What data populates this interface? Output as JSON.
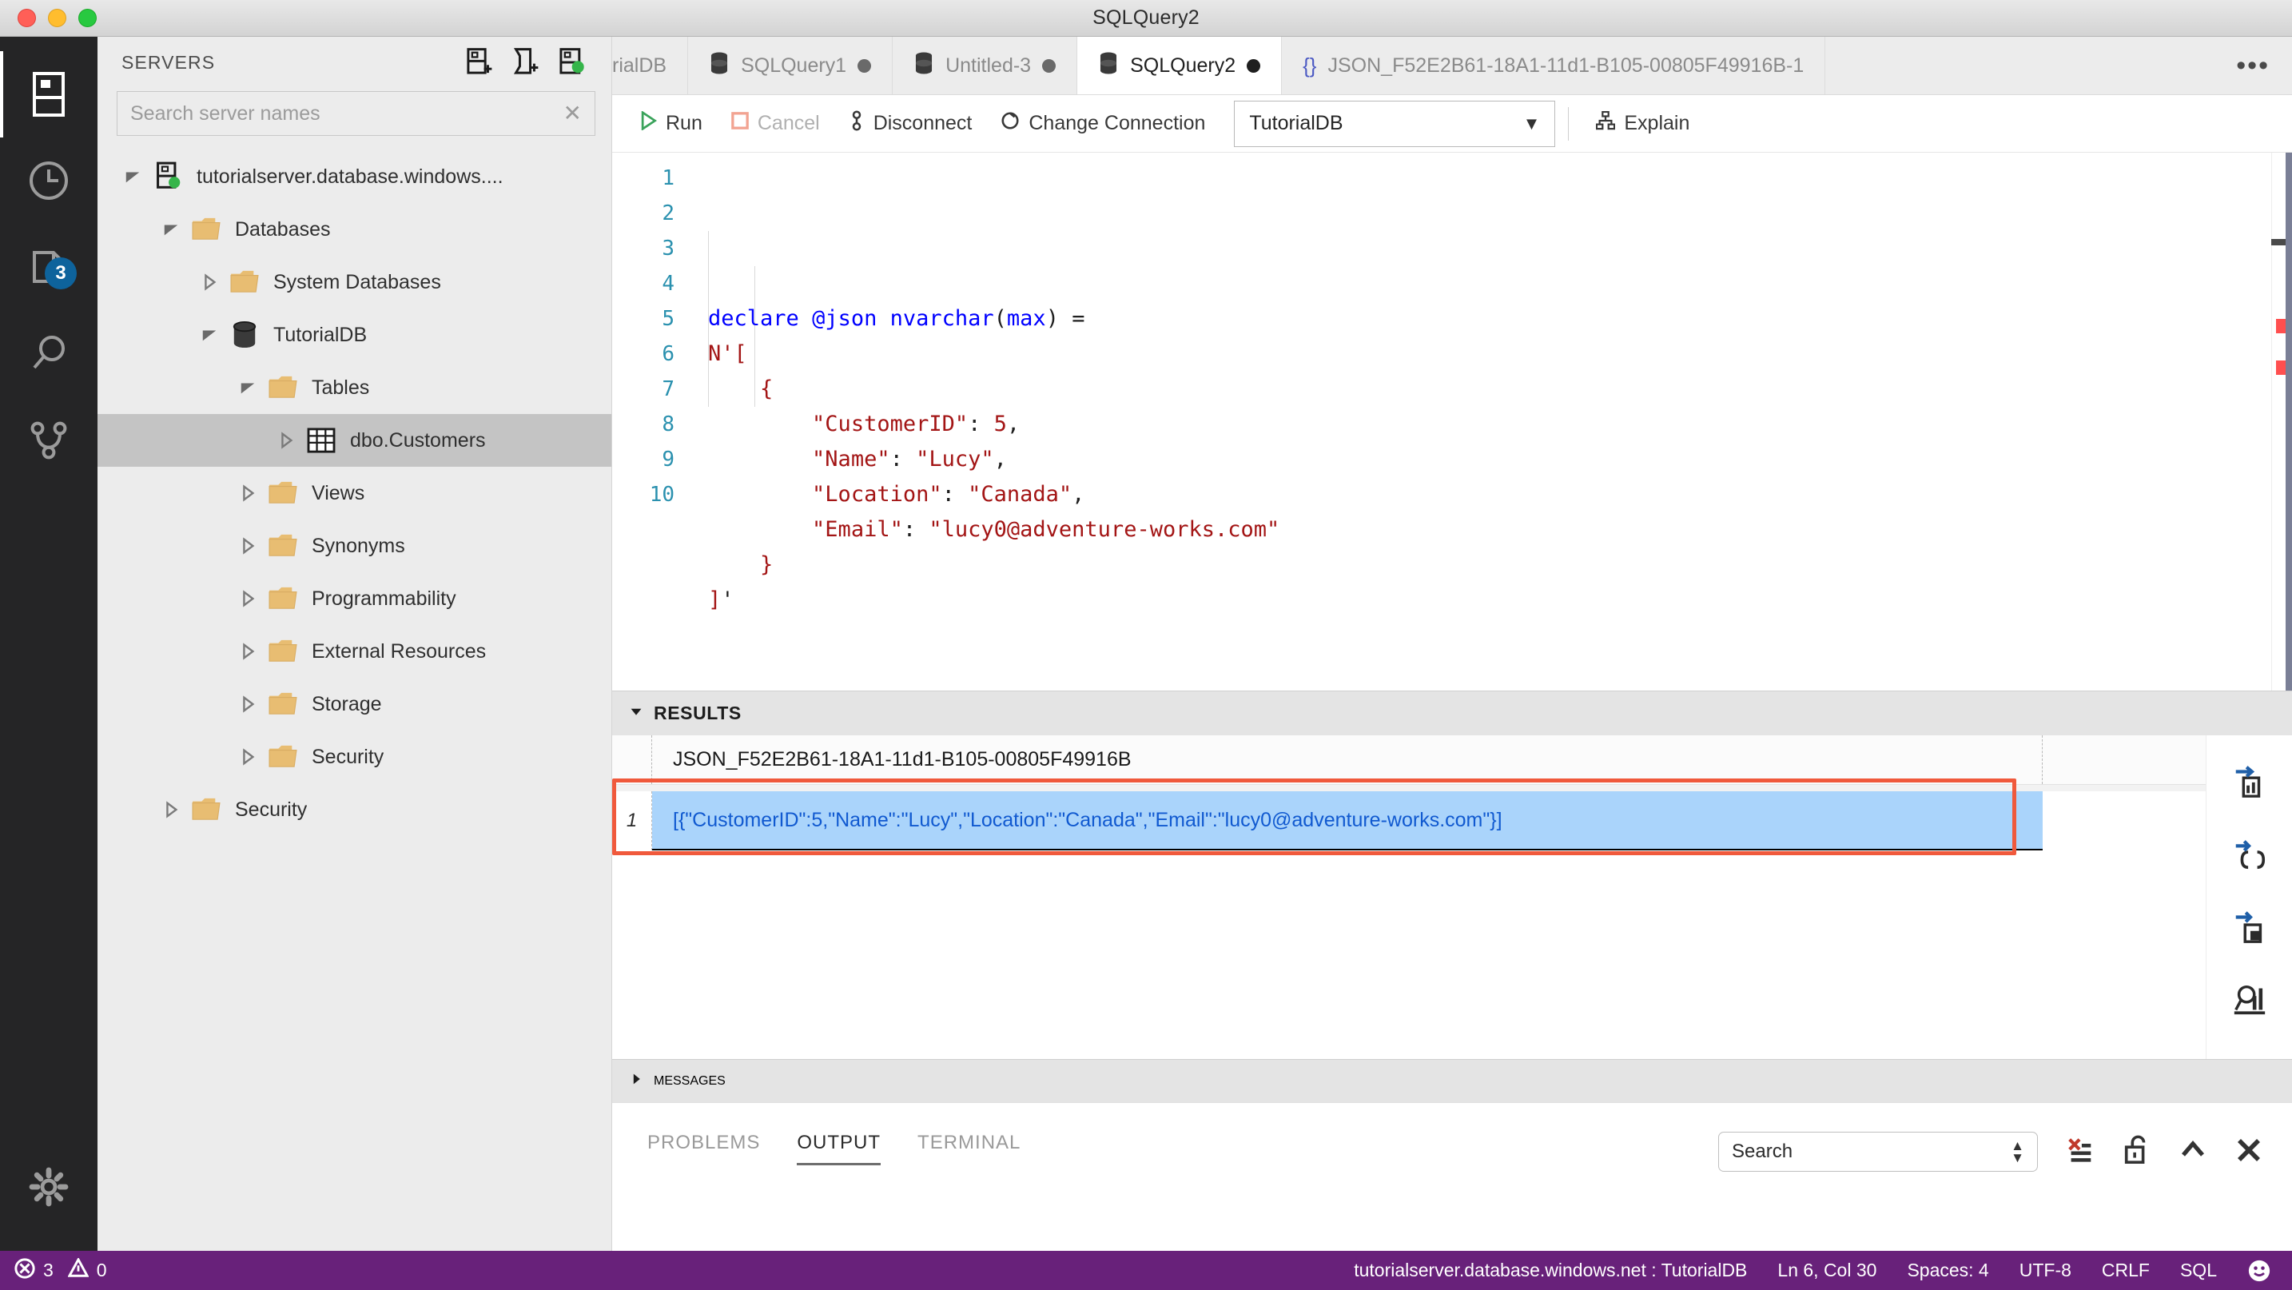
{
  "window": {
    "title": "SQLQuery2",
    "traffic_lights": [
      "close",
      "minimize",
      "zoom"
    ]
  },
  "activity_bar": {
    "items": [
      {
        "name": "servers",
        "icon": "server-icon",
        "active": true,
        "badge": ""
      },
      {
        "name": "history",
        "icon": "clock-icon",
        "active": false,
        "badge": ""
      },
      {
        "name": "explorer",
        "icon": "files-icon",
        "active": false,
        "badge": "3"
      },
      {
        "name": "search",
        "icon": "search-icon",
        "active": false,
        "badge": ""
      },
      {
        "name": "source-control",
        "icon": "source-control-icon",
        "active": false,
        "badge": ""
      }
    ],
    "bottom": {
      "name": "manage",
      "icon": "gear-icon"
    }
  },
  "sidebar": {
    "title": "SERVERS",
    "actions": [
      {
        "name": "add-connection",
        "icon": "new-connection-icon"
      },
      {
        "name": "new-server-group",
        "icon": "new-server-group-icon"
      },
      {
        "name": "show-active-connections",
        "icon": "active-connections-icon"
      }
    ],
    "search": {
      "placeholder": "Search server names",
      "value": "",
      "clear": "✕"
    },
    "tree": [
      {
        "label": "tutorialserver.database.windows....",
        "icon": "server-icon",
        "depth": 0,
        "state": "expanded",
        "selected": false
      },
      {
        "label": "Databases",
        "icon": "folder-icon",
        "depth": 1,
        "state": "expanded",
        "selected": false
      },
      {
        "label": "System Databases",
        "icon": "folder-icon",
        "depth": 2,
        "state": "collapsed",
        "selected": false
      },
      {
        "label": "TutorialDB",
        "icon": "database-icon",
        "depth": 2,
        "state": "expanded",
        "selected": false
      },
      {
        "label": "Tables",
        "icon": "folder-icon",
        "depth": 3,
        "state": "expanded",
        "selected": false
      },
      {
        "label": "dbo.Customers",
        "icon": "table-icon",
        "depth": 4,
        "state": "collapsed",
        "selected": true
      },
      {
        "label": "Views",
        "icon": "folder-icon",
        "depth": 3,
        "state": "collapsed",
        "selected": false
      },
      {
        "label": "Synonyms",
        "icon": "folder-icon",
        "depth": 3,
        "state": "collapsed",
        "selected": false
      },
      {
        "label": "Programmability",
        "icon": "folder-icon",
        "depth": 3,
        "state": "collapsed",
        "selected": false
      },
      {
        "label": "External Resources",
        "icon": "folder-icon",
        "depth": 3,
        "state": "collapsed",
        "selected": false
      },
      {
        "label": "Storage",
        "icon": "folder-icon",
        "depth": 3,
        "state": "collapsed",
        "selected": false
      },
      {
        "label": "Security",
        "icon": "folder-icon",
        "depth": 3,
        "state": "collapsed",
        "selected": false
      },
      {
        "label": "Security",
        "icon": "folder-icon",
        "depth": 1,
        "state": "collapsed",
        "selected": false
      }
    ]
  },
  "tabs": {
    "items": [
      {
        "label": "rialDB",
        "icon": "",
        "dirty": false,
        "active": false,
        "partial": true
      },
      {
        "label": "SQLQuery1",
        "icon": "database-icon",
        "dirty": true,
        "active": false,
        "partial": false
      },
      {
        "label": "Untitled-3",
        "icon": "database-icon",
        "dirty": true,
        "active": false,
        "partial": false
      },
      {
        "label": "SQLQuery2",
        "icon": "database-icon",
        "dirty": true,
        "active": true,
        "partial": false
      },
      {
        "label": "JSON_F52E2B61-18A1-11d1-B105-00805F49916B-1",
        "icon": "json-icon",
        "dirty": false,
        "active": false,
        "partial": false
      }
    ],
    "overflow": "•••"
  },
  "query_toolbar": {
    "run": "Run",
    "cancel": "Cancel",
    "disconnect": "Disconnect",
    "change_connection": "Change Connection",
    "database": "TutorialDB",
    "explain": "Explain"
  },
  "editor": {
    "line_numbers": [
      "1",
      "2",
      "3",
      "4",
      "5",
      "6",
      "7",
      "8",
      "9",
      "10"
    ],
    "current_line": 6,
    "lines": [
      "declare @json nvarchar(max) =",
      "N'[",
      "    {",
      "        \"CustomerID\": 5,",
      "        \"Name\": \"Lucy\",",
      "        \"Location\": \"Canada\",",
      "        \"Email\": \"lucy0@adventure-works.com\"",
      "    }",
      "]'",
      ""
    ]
  },
  "results": {
    "section_label": "RESULTS",
    "columns": [
      "JSON_F52E2B61-18A1-11d1-B105-00805F49916B"
    ],
    "rows": [
      {
        "num": "1",
        "cells": [
          "[{\"CustomerID\":5,\"Name\":\"Lucy\",\"Location\":\"Canada\",\"Email\":\"lucy0@adventure-works.com\"}]"
        ]
      }
    ],
    "actions": [
      {
        "name": "save-as-csv",
        "icon": "save-csv-icon"
      },
      {
        "name": "save-as-json",
        "icon": "save-json-icon"
      },
      {
        "name": "save-as-excel",
        "icon": "save-excel-icon"
      },
      {
        "name": "view-as-chart",
        "icon": "chart-icon"
      }
    ],
    "highlight_color": "#f0593c"
  },
  "messages": {
    "section_label": "MESSAGES"
  },
  "bottom_panel": {
    "tabs": [
      {
        "label": "PROBLEMS",
        "active": false
      },
      {
        "label": "OUTPUT",
        "active": true
      },
      {
        "label": "TERMINAL",
        "active": false
      }
    ],
    "select_value": "Search",
    "actions": [
      {
        "name": "clear-output",
        "icon": "clear-output-icon"
      },
      {
        "name": "lock-scroll",
        "icon": "unlock-icon"
      },
      {
        "name": "maximize-panel",
        "icon": "chevron-up-icon"
      },
      {
        "name": "close-panel",
        "icon": "close-icon"
      }
    ]
  },
  "status_bar": {
    "errors": "3",
    "warnings": "0",
    "connection": "tutorialserver.database.windows.net : TutorialDB",
    "cursor": "Ln 6, Col 30",
    "spaces": "Spaces: 4",
    "encoding": "UTF-8",
    "eol": "CRLF",
    "language": "SQL",
    "feedback": "feedback-smiley-icon",
    "background": "#68217a"
  }
}
